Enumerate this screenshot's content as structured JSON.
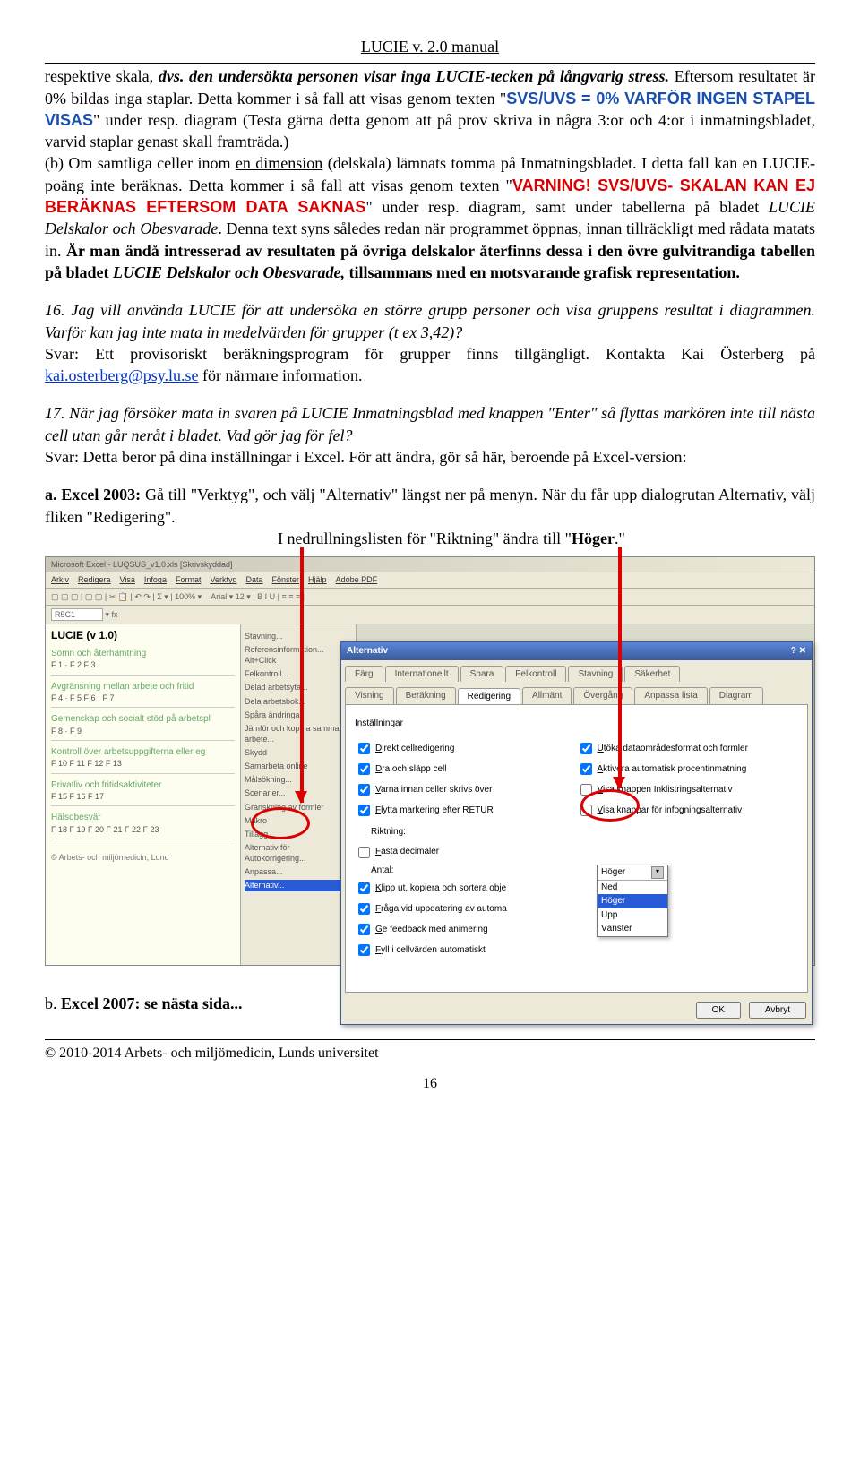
{
  "header": {
    "title": "LUCIE v. 2.0 manual"
  },
  "p1": {
    "a": "respektive skala, ",
    "b": "dvs. den undersökta personen visar inga LUCIE-tecken på långvarig stress.",
    "c": " Eftersom resultatet är 0% bildas inga staplar. Detta kommer i så fall att visas genom texten \"",
    "d": "SVS/UVS = 0% VARFÖR INGEN STAPEL VISAS",
    "e": "\" under resp. diagram (Testa gärna detta genom att på prov skriva in några 3:or och 4:or i inmatningsbladet, varvid staplar genast skall framträda.)",
    "f": "(b) Om samtliga celler inom ",
    "g": "en dimension",
    "h": " (delskala) lämnats tomma",
    "i": " på Inmatningsbladet. I detta fall kan en LUCIE-poäng inte beräknas. Detta kommer i så fall att visas genom texten \"",
    "j": "VARNING! SVS/UVS- SKALAN KAN EJ BERÄKNAS EFTERSOM DATA SAKNAS",
    "k": "\" under resp. diagram, samt under tabellerna på bladet ",
    "l": "LUCIE Delskalor och Obesvarade",
    "m": ". Denna text syns således redan när programmet öppnas, innan tillräckligt med rådata matats in. ",
    "n": "Är man ändå intresserad av resultaten på övriga delskalor återfinns dessa i den övre gulvitrandiga tabellen på bladet ",
    "o": "LUCIE Delskalor och Obesvarade,",
    "p": " tillsammans med en motsvarande grafisk representation."
  },
  "p2": {
    "q": "16. Jag vill använda LUCIE för att undersöka en större grupp personer och visa gruppens resultat i diagrammen. Varför kan jag inte mata in medelvärden för grupper (t ex 3,42)?",
    "ans_a": "Svar: Ett provisoriskt beräkningsprogram för grupper finns tillgängligt. Kontakta Kai Österberg på ",
    "link": "kai.osterberg@psy.lu.se",
    "ans_b": " för närmare information."
  },
  "p3": {
    "q": "17. När jag försöker mata in svaren på LUCIE Inmatningsblad med knappen \"Enter\" så flyttas markören inte till nästa cell utan går neråt i bladet. Vad gör jag för fel?",
    "ans": "Svar: Detta beror på dina inställningar i Excel. För att ändra, gör så här, beroende på Excel-version:"
  },
  "p4": {
    "lead": "a. ",
    "excel": "Excel 2003:",
    "tail": " Gå till \"Verktyg\", och välj \"Alternativ\" längst ner på menyn. När du får upp dialogrutan Alternativ, välj fliken \"Redigering\".",
    "line2a": "I nedrullningslisten för \"Riktning\" ändra till \"",
    "line2b": "Höger",
    "line2c": ".\""
  },
  "screenshot": {
    "apptitle": "Microsoft Excel - LUQSUS_v1.0.xls [Skrivskyddad]",
    "menu": [
      "Arkiv",
      "Redigera",
      "Visa",
      "Infoga",
      "Format",
      "Verktyg",
      "Data",
      "Fönster",
      "Hjälp",
      "Adobe PDF"
    ],
    "toolbar_zoom": "100%",
    "toolbar_font": "Arial",
    "toolbar_size": "12",
    "cellref": "R5C1",
    "lucie_title": "LUCIE (v 1.0)",
    "groups": [
      {
        "name": "Sömn och återhämtning",
        "codes": "F 1    · F 2     F 3"
      },
      {
        "name": "Avgränsning mellan arbete och fritid",
        "codes": "F 4    · F 5     F 6     · F 7"
      },
      {
        "name": "Gemenskap och socialt stöd på arbetspl",
        "codes": "F 8   · F 9"
      },
      {
        "name": "Kontroll över arbetsuppgifterna eller eg",
        "codes": "F 10    F 11    F 12    F 13"
      },
      {
        "name": "Privatliv och fritidsaktiviteter",
        "codes": "F 15    F 16    F 17"
      },
      {
        "name": "Hälsobesvär",
        "codes": "F 18    F 19    F 20    F 21    F 22    F 23"
      }
    ],
    "footer_note": "© Arbets- och miljömedicin, Lund",
    "verktyg_menu": [
      "Stavning...",
      "Referensinformation...   Alt+Click",
      "Felkontroll...",
      "Delad arbetsyta...",
      "Dela arbetsbok...",
      "Spåra ändringar",
      "Jämför och koppla samman arbete...",
      "Skydd",
      "Samarbeta online",
      "Målsökning...",
      "Scenarier...",
      "Granskning av formler",
      "Makro",
      "Tillägg...",
      "Alternativ för Autokorrigering...",
      "Anpassa...",
      "Alternativ..."
    ],
    "dialog": {
      "title": "Alternativ",
      "close_icon": "✕",
      "help_icon": "?",
      "tabs_row1": [
        "Färg",
        "Internationellt",
        "Spara",
        "Felkontroll",
        "Stavning",
        "Säkerhet"
      ],
      "tabs_row2": [
        "Visning",
        "Beräkning",
        "Redigering",
        "Allmänt",
        "Övergång",
        "Anpassa lista",
        "Diagram"
      ],
      "section": "Inställningar",
      "left_checks": [
        {
          "u": "D",
          "text": "irekt cellredigering",
          "checked": true
        },
        {
          "u": "D",
          "text": "ra och släpp cell",
          "checked": true
        },
        {
          "u": "V",
          "text": "arna innan celler skrivs över",
          "checked": true
        },
        {
          "u": "F",
          "text": "lytta markering efter RETUR",
          "checked": true
        }
      ],
      "riktning_label": "Riktning:",
      "fasta": {
        "u": "F",
        "text": "asta decimaler",
        "checked": false
      },
      "antal_label": "Antal:",
      "bottom_checks": [
        {
          "u": "K",
          "text": "lipp ut, kopiera och sortera obje",
          "checked": true
        },
        {
          "u": "F",
          "text": "råga vid uppdatering av automa",
          "checked": true
        },
        {
          "u": "G",
          "text": "e feedback med animering",
          "checked": true
        },
        {
          "u": "F",
          "text": "yll i cellvärden automatiskt",
          "checked": true
        }
      ],
      "right_checks": [
        {
          "u": "U",
          "text": "töka dataområdesformat och formler",
          "checked": true
        },
        {
          "u": "A",
          "text": "ktivera automatisk procentinmatning",
          "checked": true
        },
        {
          "u": "V",
          "text": "isa knappen Inklistringsalternativ",
          "checked": false
        },
        {
          "u": "V",
          "text": "isa knappar för infogningsalternativ",
          "checked": false
        }
      ],
      "dropdown": {
        "display": "Höger",
        "options": [
          "Ned",
          "Höger",
          "Upp",
          "Vänster"
        ],
        "selected": "Höger"
      },
      "ok": "OK",
      "cancel": "Avbryt"
    }
  },
  "p5": {
    "lead": "b. ",
    "excel": "Excel 2007: se nästa sida..."
  },
  "footer": "© 2010-2014 Arbets- och miljömedicin, Lunds universitet",
  "pagenum": "16"
}
